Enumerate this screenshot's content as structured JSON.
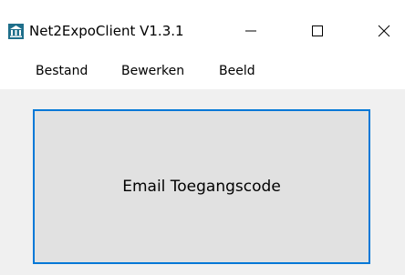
{
  "window": {
    "title": "Net2ExpoClient V1.3.1",
    "app_icon": "museum-building-icon",
    "controls": {
      "minimize_icon": "minimize-icon",
      "maximize_icon": "maximize-icon",
      "close_icon": "close-icon"
    }
  },
  "menubar": {
    "items": [
      {
        "label": "Bestand"
      },
      {
        "label": "Bewerken"
      },
      {
        "label": "Beeld"
      }
    ]
  },
  "main": {
    "button_label": "Email Toegangscode"
  },
  "colors": {
    "accent_border": "#0078d7",
    "button_face": "#e1e1e1",
    "content_bg": "#f0f0f0",
    "titlebar_bg": "#ffffff",
    "app_icon": "#1f6f8b"
  }
}
